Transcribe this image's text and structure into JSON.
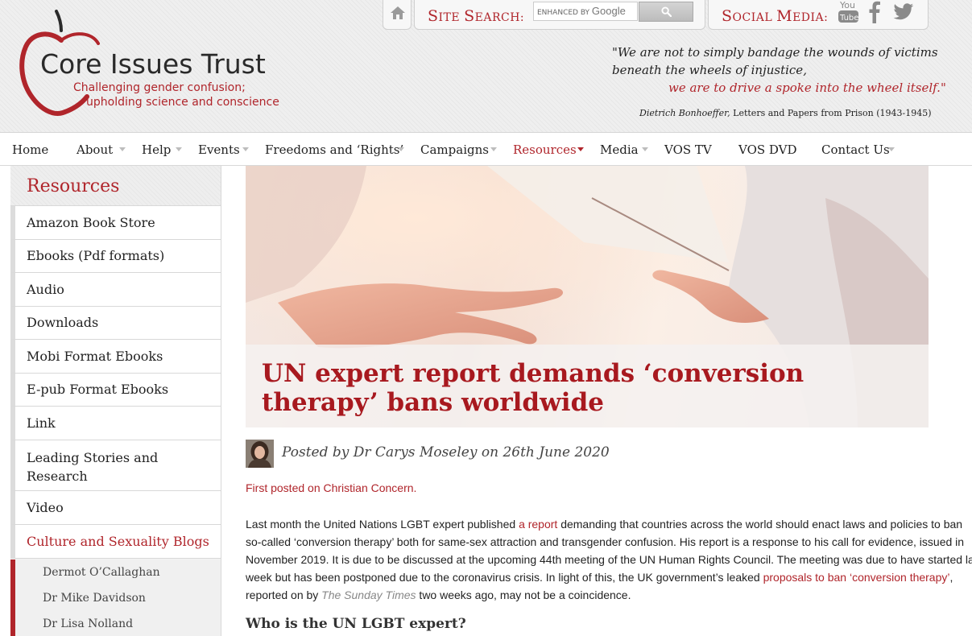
{
  "header": {
    "logo": {
      "title": "Core Issues Trust",
      "tagline_line1": "Challenging gender confusion;",
      "tagline_line2": "upholding science and conscience"
    },
    "site_search": {
      "label_first": "S",
      "label_rest": "ITE ",
      "label_second": "S",
      "label_rest2": "EARCH:",
      "placeholder_prefix": "ENHANCED BY",
      "placeholder_brand": "Google"
    },
    "social_media": {
      "label_first": "S",
      "label_rest": "OCIAL ",
      "label_second": "M",
      "label_rest2": "EDIA:",
      "icons": [
        "youtube-icon",
        "facebook-icon",
        "twitter-icon"
      ]
    },
    "quote": {
      "line1": "\"We are not to simply bandage the wounds of victims",
      "line2": "beneath the wheels of injustice,",
      "line3": "we are to drive a spoke into the wheel itself.\"",
      "attribution_name": "Dietrich Bonhoeffer,",
      "attribution_work": "Letters and Papers from Prison (1943-1945)"
    },
    "accent_color": "#b0252b"
  },
  "nav": {
    "items": [
      {
        "label": "Home",
        "has_dropdown": false,
        "active": false
      },
      {
        "label": "About",
        "has_dropdown": true,
        "active": false
      },
      {
        "label": "Help",
        "has_dropdown": true,
        "active": false
      },
      {
        "label": "Events",
        "has_dropdown": true,
        "active": false
      },
      {
        "label": "Freedoms and ‘Rights’",
        "has_dropdown": true,
        "active": false
      },
      {
        "label": "Campaigns",
        "has_dropdown": true,
        "active": false
      },
      {
        "label": "Resources",
        "has_dropdown": true,
        "active": true
      },
      {
        "label": "Media",
        "has_dropdown": true,
        "active": false
      },
      {
        "label": "VOS TV",
        "has_dropdown": false,
        "active": false
      },
      {
        "label": "VOS DVD",
        "has_dropdown": false,
        "active": false
      },
      {
        "label": "Contact Us",
        "has_dropdown": true,
        "active": false
      }
    ]
  },
  "sidebar": {
    "title": "Resources",
    "items": [
      {
        "label": "Amazon Book Store"
      },
      {
        "label": "Ebooks (Pdf formats)"
      },
      {
        "label": "Audio"
      },
      {
        "label": "Downloads"
      },
      {
        "label": "Mobi Format Ebooks"
      },
      {
        "label": "E-pub Format Ebooks"
      },
      {
        "label": "Link"
      },
      {
        "label": "Leading Stories and Research"
      },
      {
        "label": "Video"
      },
      {
        "label": "Culture and Sexuality Blogs"
      }
    ],
    "sub_items": [
      {
        "label": "Dermot O’Callaghan"
      },
      {
        "label": "Dr Mike Davidson"
      },
      {
        "label": "Dr Lisa Nolland"
      }
    ]
  },
  "article": {
    "title": "UN expert report demands ‘conversion therapy’ bans worldwide",
    "byline": "Posted by Dr Carys Moseley on 26th June 2020",
    "first_posted": "First posted on Christian Concern.",
    "paragraph": {
      "l1_a": "Last month the United Nations LGBT expert published ",
      "l1_link": "a report",
      "l1_b": " demanding that countries across the world should enact laws and policies to ban",
      "l2": "so-called ‘conversion therapy’ both for same-sex attraction and transgender confusion. His report is a response to his call for evidence, issued in",
      "l3": "November 2019. It is due to be discussed at the upcoming 44th meeting of the UN Human Rights Council. The meeting was due to have started last",
      "l4_a": "week but has been postponed due to the coronavirus crisis. In light of this, the UK government’s leaked ",
      "l4_link": "proposals to ban ‘conversion therapy’",
      "l4_b": ",",
      "l5_a": "reported on by ",
      "l5_em": "The Sunday Times",
      "l5_b": " two weeks ago, may not be a coincidence."
    },
    "subheading": "Who is the UN LGBT expert?"
  }
}
